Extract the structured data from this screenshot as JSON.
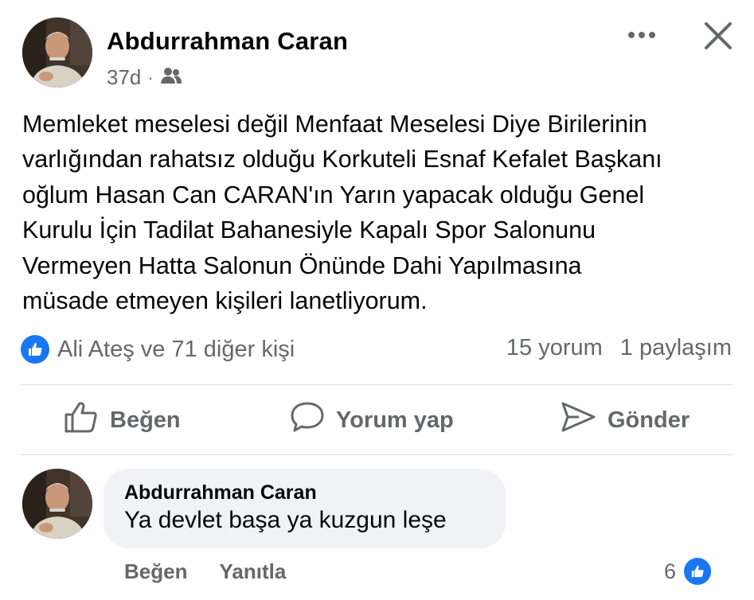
{
  "post": {
    "author": "Abdurrahman Caran",
    "time": "37d",
    "dot": "·",
    "audience_icon": "friends-icon",
    "text_lines": [
      "Memleket meselesi değil Menfaat Meselesi Diye Birilerinin",
      "varlığından rahatsız olduğu Korkuteli Esnaf Kefalet Başkanı",
      "oğlum Hasan Can CARAN'ın Yarın yapacak olduğu Genel",
      "Kurulu İçin Tadilat Bahanesiyle Kapalı Spor Salonunu",
      "Vermeyen Hatta Salonun Önünde Dahi Yapılmasına",
      "müsade etmeyen kişileri lanetliyorum."
    ]
  },
  "reactions": {
    "summary": "Ali Ateş ve 71 diğer kişi",
    "comments_count": "15 yorum",
    "shares_count": "1 paylaşım"
  },
  "actions": {
    "like": "Beğen",
    "comment": "Yorum yap",
    "send": "Gönder"
  },
  "comment": {
    "author": "Abdurrahman Caran",
    "text": "Ya devlet başa ya kuzgun leşe",
    "like_label": "Beğen",
    "reply_label": "Yanıtla",
    "reaction_count": "6"
  },
  "colors": {
    "accent": "#1877f2",
    "secondary_text": "#65676b",
    "bubble": "#f0f2f5",
    "divider": "#dadde1"
  }
}
